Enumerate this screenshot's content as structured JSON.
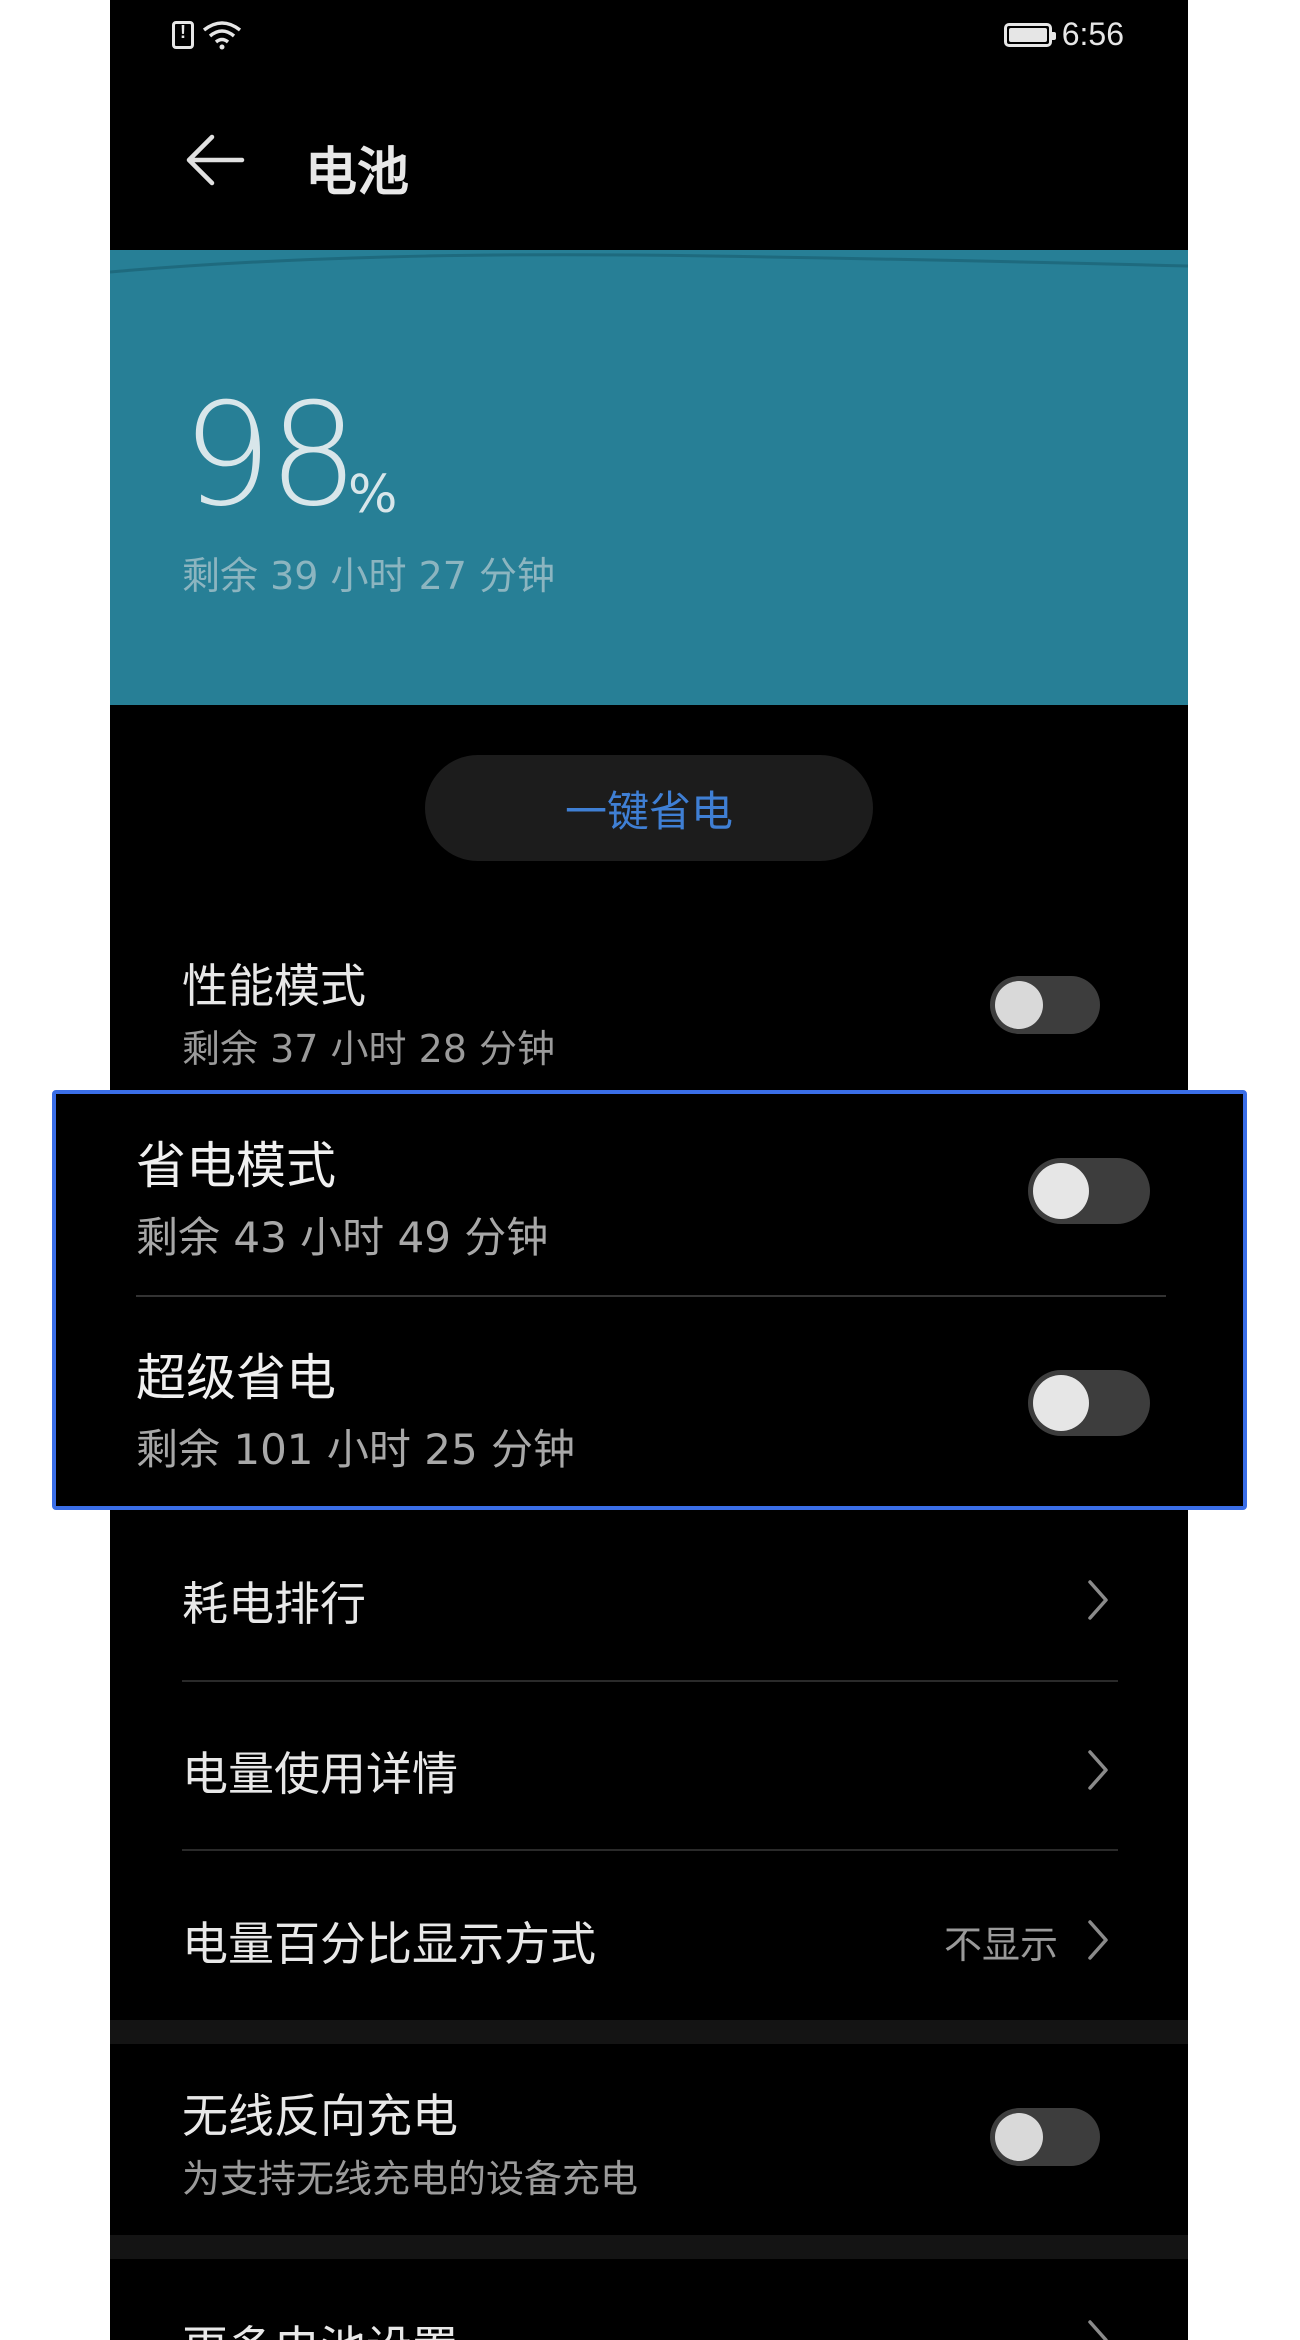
{
  "status_bar": {
    "sim_icon": "sim-alert-icon",
    "wifi_icon": "wifi-icon",
    "battery_icon": "battery-full-icon",
    "time": "6:56"
  },
  "app_bar": {
    "back_icon": "back-arrow-icon",
    "title": "电池"
  },
  "battery": {
    "level_percent": 98,
    "level_text": "98",
    "percent_sign": "%",
    "remaining": "剩余 39 小时 27 分钟",
    "banner_color": "#277f96"
  },
  "one_tap_button": {
    "label": "一键省电",
    "color": "#3f7fd4"
  },
  "modes": {
    "performance": {
      "title": "性能模式",
      "subtitle": "剩余 37 小时 28 分钟",
      "enabled": false
    },
    "power_saving": {
      "title": "省电模式",
      "subtitle": "剩余 43 小时 49 分钟",
      "enabled": false
    },
    "ultra_power_saving": {
      "title": "超级省电",
      "subtitle": "剩余 101 小时 25 分钟",
      "enabled": false
    }
  },
  "menu": {
    "consumption_ranking": {
      "title": "耗电排行",
      "icon": "chevron-right-icon"
    },
    "usage_details": {
      "title": "电量使用详情",
      "icon": "chevron-right-icon"
    },
    "percentage_display": {
      "title": "电量百分比显示方式",
      "value": "不显示",
      "icon": "chevron-right-icon"
    }
  },
  "wireless_reverse": {
    "title": "无线反向充电",
    "subtitle": "为支持无线充电的设备充电",
    "enabled": false
  },
  "more_settings": {
    "title": "更多电池设置",
    "icon": "chevron-right-icon"
  },
  "highlight_color": "#3a6ee8"
}
